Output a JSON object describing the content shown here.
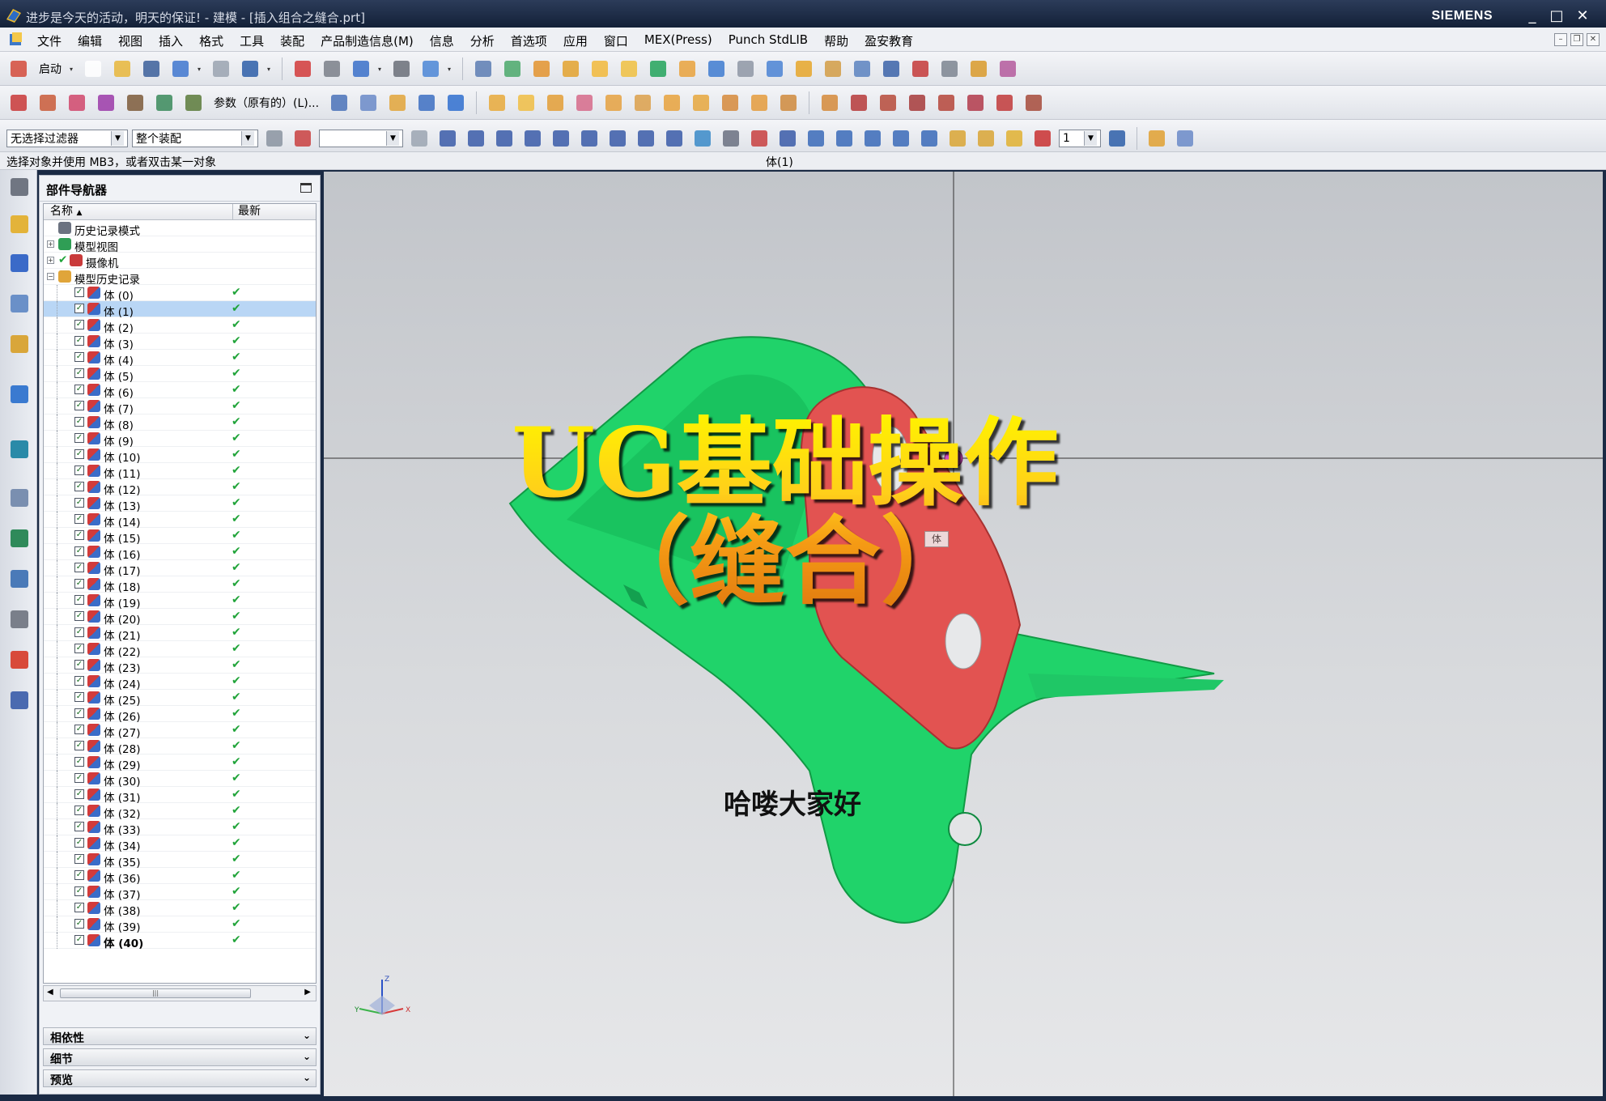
{
  "window": {
    "title": "进步是今天的活动，明天的保证! - 建模 - [插入组合之缝合.prt]",
    "brand": "SIEMENS",
    "controls": [
      "_",
      "□",
      "✕"
    ]
  },
  "menubar": {
    "items": [
      "文件",
      "编辑",
      "视图",
      "插入",
      "格式",
      "工具",
      "装配",
      "产品制造信息(M)",
      "信息",
      "分析",
      "首选项",
      "应用",
      "窗口",
      "MEX(Press)",
      "Punch StdLIB",
      "帮助",
      "盈安教育"
    ]
  },
  "toolbar1": {
    "start_label": "启动"
  },
  "toolbar2": {
    "param_label": "参数（原有的）(L)..."
  },
  "toolbar3": {
    "filter_value": "无选择过滤器",
    "scope_value": "整个装配",
    "blank_value": "",
    "layer_value": "1"
  },
  "status": {
    "prompt": "选择对象并使用 MB3，或者双击某一对象",
    "selection": "体(1)"
  },
  "navigator": {
    "title": "部件导航器",
    "col_name": "名称",
    "col_latest": "最新",
    "top_nodes": [
      {
        "label": "历史记录模式",
        "icon": "clock-icon"
      },
      {
        "label": "模型视图",
        "icon": "view-icon"
      },
      {
        "label": "摄像机",
        "icon": "camera-icon"
      },
      {
        "label": "模型历史记录",
        "icon": "folder-icon"
      }
    ],
    "bodies": [
      "体 (0)",
      "体 (1)",
      "体 (2)",
      "体 (3)",
      "体 (4)",
      "体 (5)",
      "体 (6)",
      "体 (7)",
      "体 (8)",
      "体 (9)",
      "体 (10)",
      "体 (11)",
      "体 (12)",
      "体 (13)",
      "体 (14)",
      "体 (15)",
      "体 (16)",
      "体 (17)",
      "体 (18)",
      "体 (19)",
      "体 (20)",
      "体 (21)",
      "体 (22)",
      "体 (23)",
      "体 (24)",
      "体 (25)",
      "体 (26)",
      "体 (27)",
      "体 (28)",
      "体 (29)",
      "体 (30)",
      "体 (31)",
      "体 (32)",
      "体 (33)",
      "体 (34)",
      "体 (35)",
      "体 (36)",
      "体 (37)",
      "体 (38)",
      "体 (39)",
      "体 (40)"
    ],
    "selected_index": 1,
    "latest_mark": "✔",
    "sections": [
      "相依性",
      "细节",
      "预览"
    ]
  },
  "viewport": {
    "overlay_line1": "UG基础操作",
    "overlay_line2": "（缝合）",
    "subtitle": "哈喽大家好",
    "tag": "体",
    "colors": {
      "part_green": "#1fd468",
      "face_red": "#e2504f",
      "bg": "#d4d6d9"
    }
  }
}
